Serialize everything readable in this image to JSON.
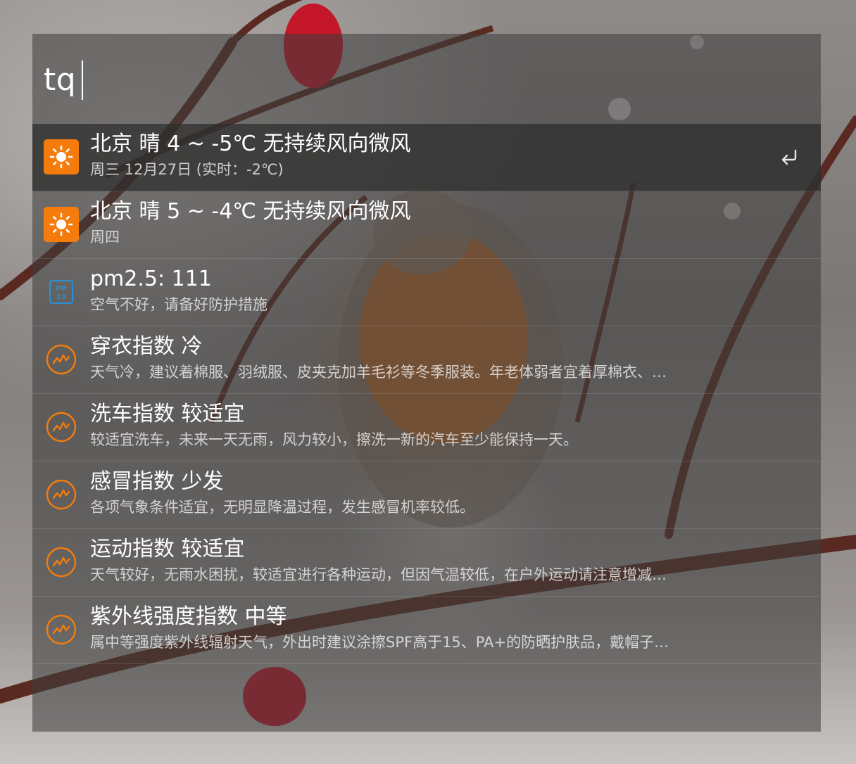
{
  "search": {
    "query": "tq"
  },
  "results": [
    {
      "title": "北京 晴 4 ~ -5℃ 无持续风向微风",
      "subtitle": "周三 12月27日 (实时：-2℃)",
      "icon": "sun-icon",
      "selected": true
    },
    {
      "title": "北京 晴 5 ~ -4℃ 无持续风向微风",
      "subtitle": "周四",
      "icon": "sun-icon",
      "selected": false
    },
    {
      "title": "pm2.5: 111",
      "subtitle": "空气不好，请备好防护措施",
      "icon": "pm25-icon",
      "icon_text_top": "PM",
      "icon_text_bottom": "2.5",
      "selected": false
    },
    {
      "title": "穿衣指数 冷",
      "subtitle": "天气冷，建议着棉服、羽绒服、皮夹克加羊毛衫等冬季服装。年老体弱者宜着厚棉衣、…",
      "icon": "index-chart-icon",
      "selected": false
    },
    {
      "title": "洗车指数 较适宜",
      "subtitle": "较适宜洗车，未来一天无雨，风力较小，擦洗一新的汽车至少能保持一天。",
      "icon": "index-chart-icon",
      "selected": false
    },
    {
      "title": "感冒指数 少发",
      "subtitle": "各项气象条件适宜，无明显降温过程，发生感冒机率较低。",
      "icon": "index-chart-icon",
      "selected": false
    },
    {
      "title": "运动指数 较适宜",
      "subtitle": "天气较好，无雨水困扰，较适宜进行各种运动，但因气温较低，在户外运动请注意增减…",
      "icon": "index-chart-icon",
      "selected": false
    },
    {
      "title": "紫外线强度指数 中等",
      "subtitle": "属中等强度紫外线辐射天气，外出时建议涂擦SPF高于15、PA+的防晒护肤品，戴帽子…",
      "icon": "index-chart-icon",
      "selected": false
    }
  ],
  "colors": {
    "accent": "#f57c0c",
    "pm_icon": "#2a8fd6",
    "selected_row": "#2d2d2d"
  }
}
